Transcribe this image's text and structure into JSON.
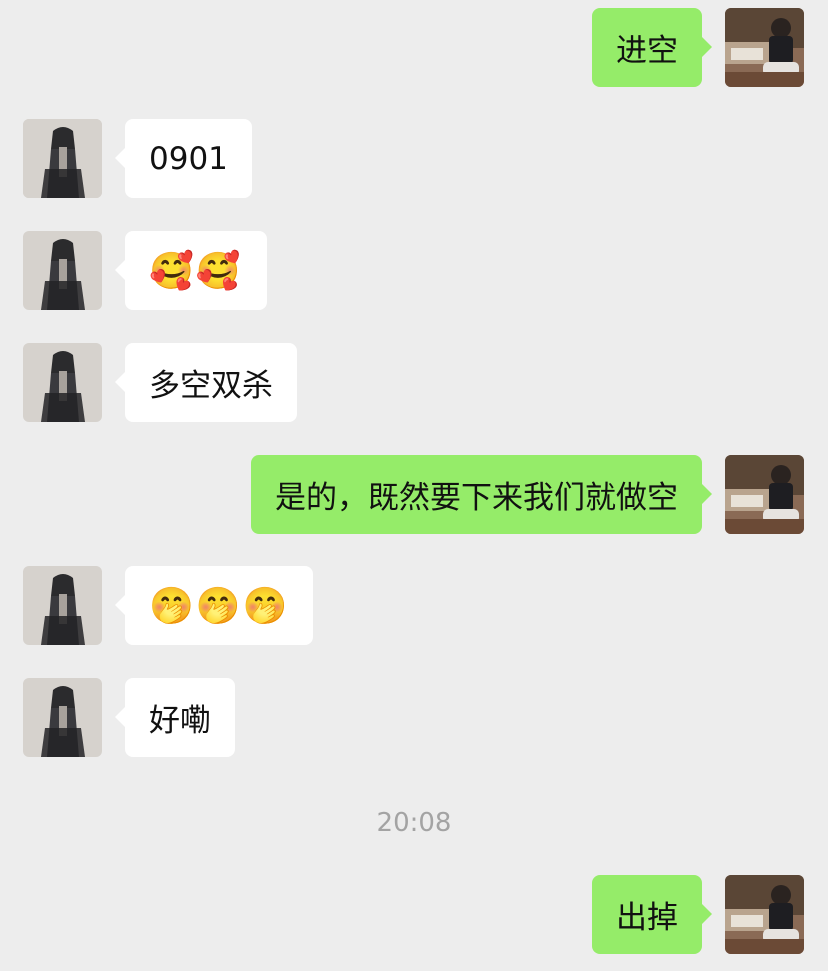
{
  "messages": [
    {
      "side": "out",
      "text": "进空",
      "kind": "text"
    },
    {
      "side": "in",
      "text": "0901",
      "kind": "text"
    },
    {
      "side": "in",
      "text": "🥰🥰",
      "kind": "emoji"
    },
    {
      "side": "in",
      "text": "多空双杀",
      "kind": "text"
    },
    {
      "side": "out",
      "text": "是的，既然要下来我们就做空",
      "kind": "text"
    },
    {
      "side": "in",
      "text": "🤭🤭🤭",
      "kind": "emoji"
    },
    {
      "side": "in",
      "text": "好嘞",
      "kind": "text"
    },
    {
      "side": "out",
      "text": "出掉",
      "kind": "text"
    }
  ],
  "timestamp": "20:08",
  "colors": {
    "background": "#ededed",
    "outgoing_bubble": "#95ec69",
    "incoming_bubble": "#ffffff",
    "timestamp_text": "#a3a3a3"
  },
  "icons": {
    "self_avatar": "self-avatar-photo",
    "contact_avatar": "contact-avatar-photo"
  }
}
